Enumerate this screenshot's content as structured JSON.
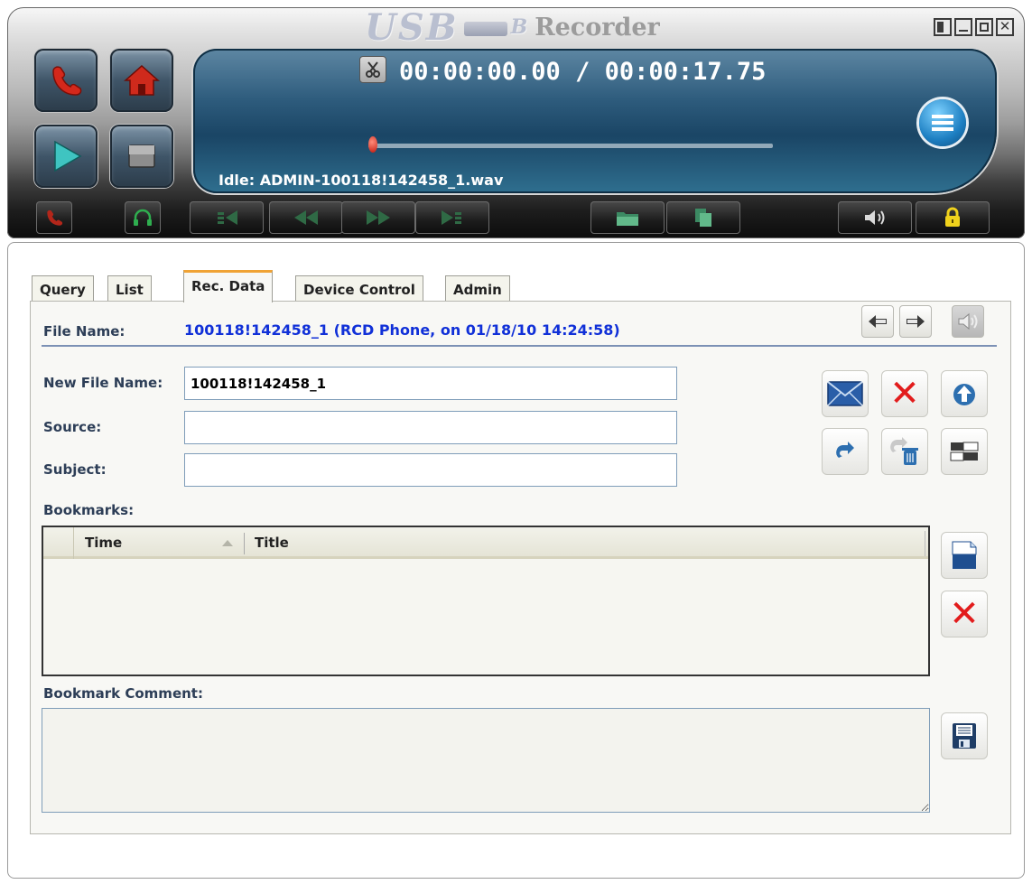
{
  "app": {
    "logo_usb": "USB",
    "logo_b": "B",
    "logo_recorder": "Recorder",
    "icons": [
      "restore-icon",
      "minimize-icon",
      "maximize-icon",
      "close-icon"
    ]
  },
  "player": {
    "time_current": "00:00:00.00",
    "time_separator": "/",
    "time_total": "00:00:17.75",
    "status_text": "Idle: ADMIN-100118!142458_1.wav",
    "position_fraction": 0.0,
    "colors": {
      "accent_red": "#c4190d",
      "display_blue": "#2e5c7d",
      "control_green": "#2f6a45"
    }
  },
  "tabs": [
    {
      "label": "Query"
    },
    {
      "label": "List"
    },
    {
      "label": "Rec. Data",
      "active": true
    },
    {
      "label": "Device Control"
    },
    {
      "label": "Admin"
    }
  ],
  "rec_data": {
    "file_name_label": "File Name:",
    "file_name_value": "100118!142458_1 (RCD Phone, on 01/18/10 14:24:58)",
    "new_file_name_label": "New File Name:",
    "new_file_name_value": "100118!142458_1",
    "source_label": "Source:",
    "source_value": "",
    "subject_label": "Subject:",
    "subject_value": "",
    "bookmarks_label": "Bookmarks:",
    "bookmarks_columns": [
      "Time",
      "Title"
    ],
    "bookmarks_rows": [],
    "bookmark_comment_label": "Bookmark Comment:",
    "bookmark_comment_value": ""
  }
}
